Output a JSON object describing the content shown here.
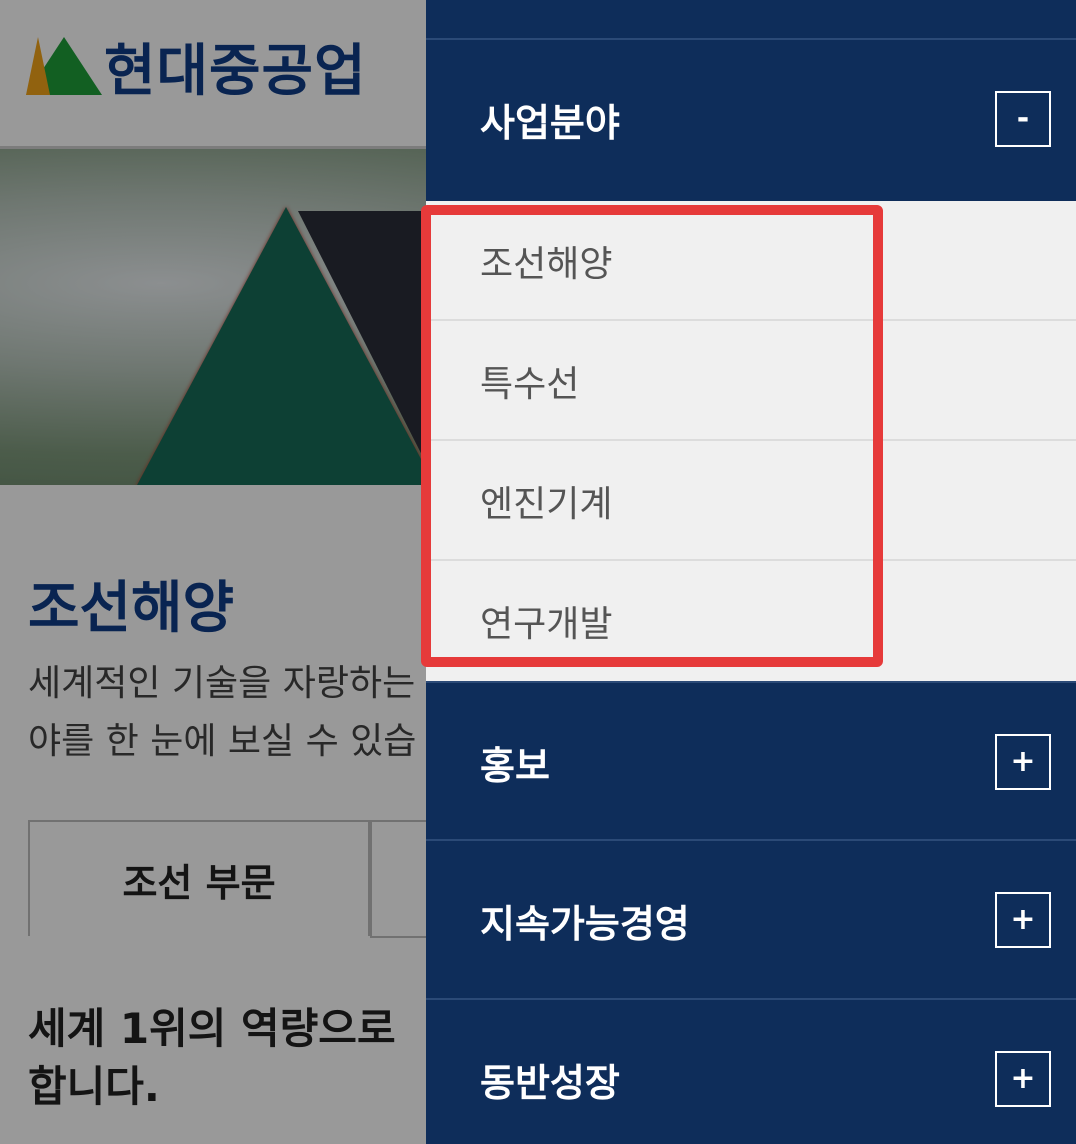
{
  "header": {
    "logo_text": "현대중공업"
  },
  "main": {
    "section_title": "조선해양",
    "section_desc": "세계적인 기술을 자랑하는\n야를 한 눈에 보실 수 있습",
    "tabs": [
      {
        "label": "조선 부문"
      },
      {
        "label": ""
      }
    ],
    "subheading": "세계 1위의 역량으로\n합니다."
  },
  "sidemenu": {
    "groups": [
      {
        "label": "사업분야",
        "toggle": "-"
      },
      {
        "label": "홍보",
        "toggle": "+"
      },
      {
        "label": "지속가능경영",
        "toggle": "+"
      },
      {
        "label": "동반성장",
        "toggle": "+"
      }
    ],
    "submenu_items": [
      {
        "label": "조선해양"
      },
      {
        "label": "특수선"
      },
      {
        "label": "엔진기계"
      },
      {
        "label": "연구개발"
      }
    ]
  },
  "colors": {
    "menu_bg": "#0e2d5a",
    "brand_blue": "#0f3d87",
    "highlight": "#e63a3a",
    "submenu_bg": "#f0f0f0"
  }
}
